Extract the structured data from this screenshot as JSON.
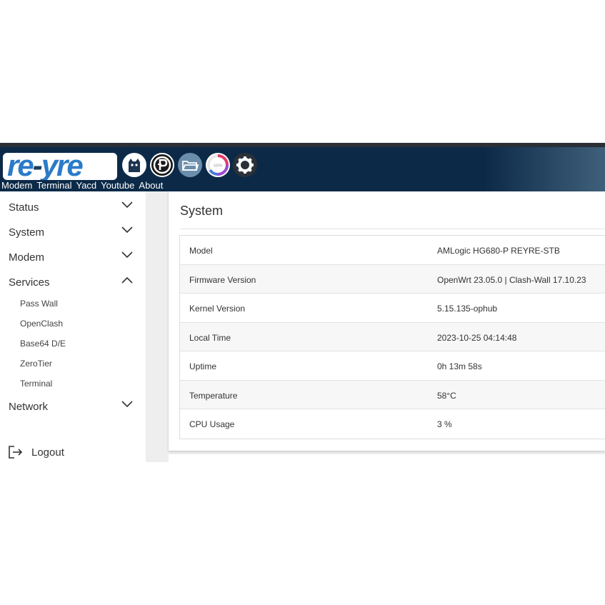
{
  "header": {
    "logo_text": "re-yre",
    "links": [
      "Modem",
      "Terminal",
      "Yacd",
      "Youtube",
      "About"
    ],
    "icons": [
      "cat-icon",
      "p-icon",
      "folder-icon",
      "gauge-icon",
      "gear-icon"
    ],
    "gauge_text": "100%"
  },
  "sidebar": {
    "items": [
      {
        "label": "Status",
        "state": "collapsed"
      },
      {
        "label": "System",
        "state": "collapsed"
      },
      {
        "label": "Modem",
        "state": "collapsed"
      },
      {
        "label": "Services",
        "state": "expanded"
      },
      {
        "label": "Network",
        "state": "collapsed"
      }
    ],
    "services_children": [
      "Pass Wall",
      "OpenClash",
      "Base64 D/E",
      "ZeroTier",
      "Terminal"
    ],
    "logout_label": "Logout"
  },
  "main": {
    "title": "System",
    "rows": [
      {
        "key": "Model",
        "value": "AMLogic HG680-P REYRE-STB"
      },
      {
        "key": "Firmware Version",
        "value": "OpenWrt 23.05.0 | Clash-Wall 17.10.23"
      },
      {
        "key": "Kernel Version",
        "value": "5.15.135-ophub"
      },
      {
        "key": "Local Time",
        "value": "2023-10-25 04:14:48"
      },
      {
        "key": "Uptime",
        "value": "0h 13m 58s"
      },
      {
        "key": "Temperature",
        "value": "58°C"
      },
      {
        "key": "CPU Usage",
        "value": "3 %"
      }
    ]
  },
  "colors": {
    "header_bg": "#0c2a48",
    "logo_blue": "#2a7bc8",
    "page_bg": "#eeeeee"
  }
}
